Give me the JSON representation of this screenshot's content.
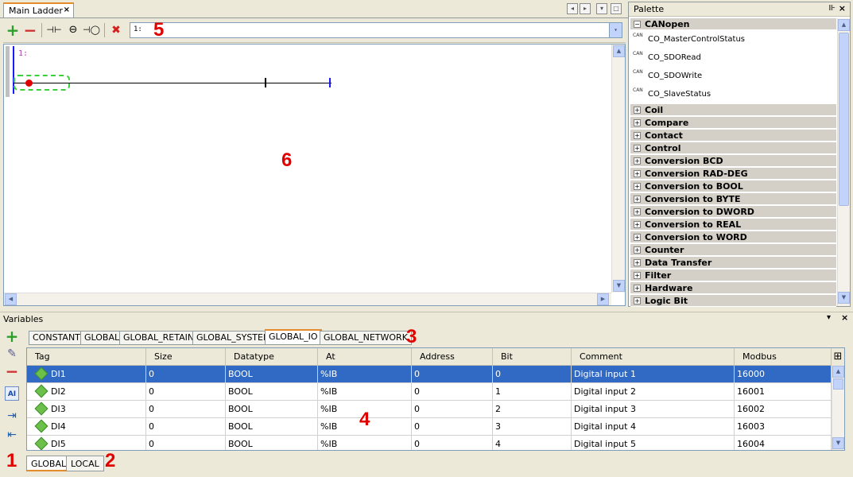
{
  "editor_tab": {
    "title": "Main Ladder",
    "close": "×"
  },
  "nav": {
    "prev": "◂",
    "next": "▸",
    "menu": "▾",
    "max": "□"
  },
  "toolbar": {
    "add": "+",
    "remove": "−",
    "contact": "⊣⊢",
    "coil": "⊖",
    "branch": "⊣◯",
    "delete": "✖"
  },
  "rung_select": {
    "value": "1:",
    "arrow": "▾"
  },
  "markers": {
    "m1": "1",
    "m2": "2",
    "m3": "3",
    "m4": "4",
    "m5": "5",
    "m6": "6"
  },
  "editor": {
    "rung_label": "1:"
  },
  "scroll": {
    "up": "▲",
    "down": "▼",
    "left": "◀",
    "right": "▶"
  },
  "palette": {
    "title": "Palette",
    "pin": "⊪",
    "close": "×",
    "expanded": {
      "label": "CANopen",
      "toggle": "−"
    },
    "items": [
      {
        "label": "CO_MasterControlStatus",
        "icon": "CAN"
      },
      {
        "label": "CO_SDORead",
        "icon": "CAN"
      },
      {
        "label": "CO_SDOWrite",
        "icon": "CAN"
      },
      {
        "label": "CO_SlaveStatus",
        "icon": "CAN"
      }
    ],
    "categories": [
      {
        "label": "Coil",
        "toggle": "+"
      },
      {
        "label": "Compare",
        "toggle": "+"
      },
      {
        "label": "Contact",
        "toggle": "+"
      },
      {
        "label": "Control",
        "toggle": "+"
      },
      {
        "label": "Conversion BCD",
        "toggle": "+"
      },
      {
        "label": "Conversion RAD-DEG",
        "toggle": "+"
      },
      {
        "label": "Conversion to BOOL",
        "toggle": "+"
      },
      {
        "label": "Conversion to BYTE",
        "toggle": "+"
      },
      {
        "label": "Conversion to DWORD",
        "toggle": "+"
      },
      {
        "label": "Conversion to REAL",
        "toggle": "+"
      },
      {
        "label": "Conversion to WORD",
        "toggle": "+"
      },
      {
        "label": "Counter",
        "toggle": "+"
      },
      {
        "label": "Data Transfer",
        "toggle": "+"
      },
      {
        "label": "Filter",
        "toggle": "+"
      },
      {
        "label": "Hardware",
        "toggle": "+"
      },
      {
        "label": "Logic Bit",
        "toggle": "+"
      }
    ]
  },
  "variables": {
    "title": "Variables",
    "menu": "▾",
    "close": "×",
    "side": {
      "add": "+",
      "edit": "✎",
      "remove": "−",
      "ai": "AI",
      "import": "⇥",
      "export": "⇤"
    },
    "group_tabs": [
      "CONSTANT",
      "GLOBAL",
      "GLOBAL_RETAIN",
      "GLOBAL_SYSTEM",
      "GLOBAL_IO",
      "GLOBAL_NETWORK"
    ],
    "active_group": "GLOBAL_IO",
    "columns": [
      "Tag",
      "Size",
      "Datatype",
      "At",
      "Address",
      "Bit",
      "Comment",
      "Modbus"
    ],
    "corner_icon": "⊞",
    "rows": [
      [
        "DI1",
        "0",
        "BOOL",
        "%IB",
        "0",
        "0",
        "Digital input 1",
        "16000"
      ],
      [
        "DI2",
        "0",
        "BOOL",
        "%IB",
        "0",
        "1",
        "Digital input 2",
        "16001"
      ],
      [
        "DI3",
        "0",
        "BOOL",
        "%IB",
        "0",
        "2",
        "Digital input 3",
        "16002"
      ],
      [
        "DI4",
        "0",
        "BOOL",
        "%IB",
        "0",
        "3",
        "Digital input 4",
        "16003"
      ],
      [
        "DI5",
        "0",
        "BOOL",
        "%IB",
        "0",
        "4",
        "Digital input 5",
        "16004"
      ]
    ],
    "scope_tabs": [
      "GLOBAL",
      "LOCAL"
    ]
  }
}
